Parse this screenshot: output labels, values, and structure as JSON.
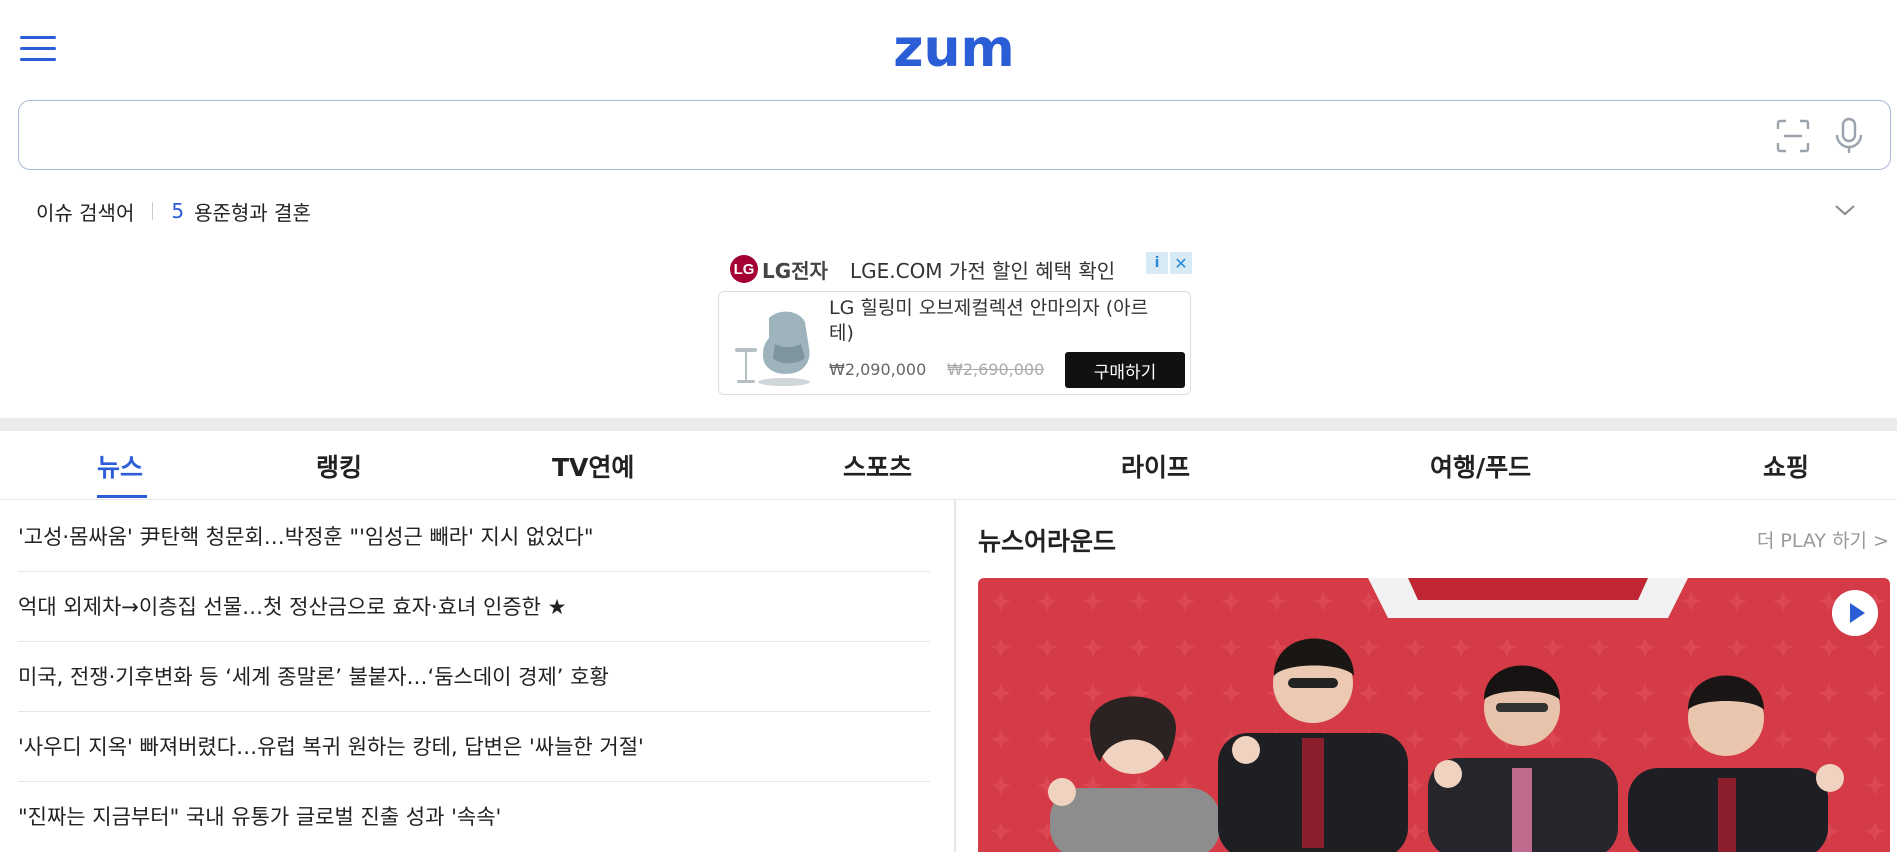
{
  "header": {
    "logo_text": "zum",
    "brand_color": "#2b5ed6"
  },
  "search": {
    "value": "",
    "placeholder": ""
  },
  "issue": {
    "label": "이슈 검색어",
    "rank": "5",
    "keyword": "용준형과 결혼"
  },
  "ad": {
    "brand_mark": "LG",
    "brand": "LG전자",
    "headline": "LGE.COM 가전 할인 혜택 확인",
    "product": "LG 힐링미 오브제컬렉션 안마의자 (아르테)",
    "price": "₩2,090,000",
    "old_price": "₩2,690,000",
    "buy_label": "구매하기"
  },
  "tabs": [
    {
      "label": "뉴스",
      "active": true
    },
    {
      "label": "랭킹"
    },
    {
      "label": "TV연예"
    },
    {
      "label": "스포츠"
    },
    {
      "label": "라이프"
    },
    {
      "label": "여행/푸드"
    },
    {
      "label": "쇼핑"
    }
  ],
  "news": [
    "'고성·몸싸움' 尹탄핵 청문회…박정훈 \"'임성근 빼라' 지시 없었다\"",
    "억대 외제차→이층집 선물…첫 정산금으로 효자·효녀 인증한 ★",
    "미국, 전쟁·기후변화 등 ‘세계 종말론’ 불붙자…‘둠스데이 경제’ 호황",
    "'사우디 지옥' 빠져버렸다…유럽 복귀 원하는 캉테, 답변은 '싸늘한 거절'",
    "\"진짜는 지금부터\" 국내 유통가 글로벌 진출 성과 '속속'"
  ],
  "news_around": {
    "title": "뉴스어라운드",
    "more_label": "더 PLAY 하기 >"
  }
}
